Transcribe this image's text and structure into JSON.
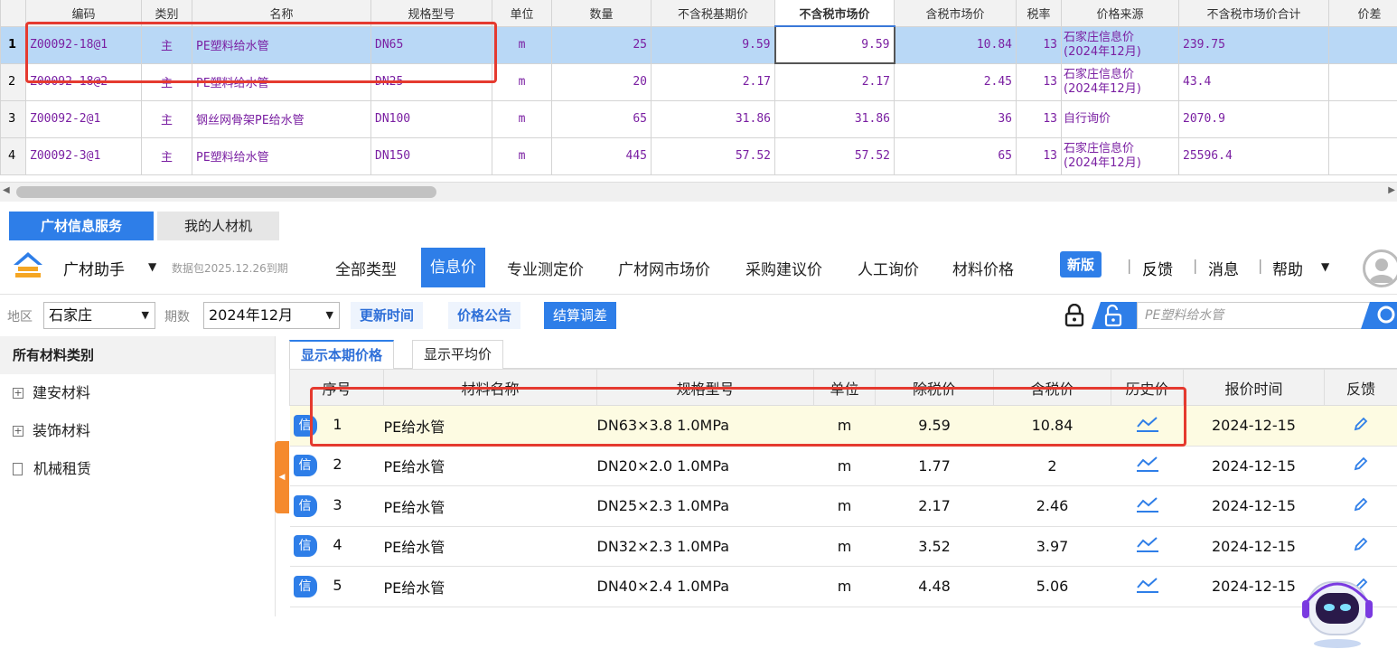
{
  "top_grid": {
    "columns": [
      "编码",
      "类别",
      "名称",
      "规格型号",
      "单位",
      "数量",
      "不含税基期价",
      "不含税市场价",
      "含税市场价",
      "税率",
      "价格来源",
      "不含税市场价合计",
      "价差"
    ],
    "rows": [
      {
        "n": "1",
        "code": "Z00092-18@1",
        "cat": "主",
        "name": "PE塑料给水管",
        "spec": "DN65",
        "unit": "m",
        "qty": "25",
        "base": "9.59",
        "market": "9.59",
        "tax_market": "10.84",
        "rate": "13",
        "src1": "石家庄信息价",
        "src2": "(2024年12月)",
        "total": "239.75"
      },
      {
        "n": "2",
        "code": "Z00092-18@2",
        "cat": "主",
        "name": "PE塑料给水管",
        "spec": "DN25",
        "unit": "m",
        "qty": "20",
        "base": "2.17",
        "market": "2.17",
        "tax_market": "2.45",
        "rate": "13",
        "src1": "石家庄信息价",
        "src2": "(2024年12月)",
        "total": "43.4"
      },
      {
        "n": "3",
        "code": "Z00092-2@1",
        "cat": "主",
        "name": "钢丝网骨架PE给水管",
        "spec": "DN100",
        "unit": "m",
        "qty": "65",
        "base": "31.86",
        "market": "31.86",
        "tax_market": "36",
        "rate": "13",
        "src1": "自行询价",
        "src2": "",
        "total": "2070.9"
      },
      {
        "n": "4",
        "code": "Z00092-3@1",
        "cat": "主",
        "name": "PE塑料给水管",
        "spec": "DN150",
        "unit": "m",
        "qty": "445",
        "base": "57.52",
        "market": "57.52",
        "tax_market": "65",
        "rate": "13",
        "src1": "石家庄信息价",
        "src2": "(2024年12月)",
        "total": "25596.4"
      }
    ]
  },
  "panel_tabs": [
    "广材信息服务",
    "我的人材机"
  ],
  "assistant": {
    "title": "广材助手",
    "package_expiry": "数据包2025.12.26到期",
    "nav": [
      "全部类型",
      "信息价",
      "专业测定价",
      "广材网市场价",
      "采购建议价",
      "人工询价",
      "材料价格"
    ],
    "active_nav": "信息价",
    "new_badge": "新版",
    "links": [
      "反馈",
      "消息",
      "帮助"
    ],
    "sep": "|",
    "caret": "▼"
  },
  "filters": {
    "region_label": "地区",
    "region_value": "石家庄",
    "period_label": "期数",
    "period_value": "2024年12月",
    "buttons": [
      "更新时间",
      "价格公告",
      "结算调差"
    ],
    "search_placeholder": "PE塑料给水管"
  },
  "tree": {
    "header": "所有材料类别",
    "items": [
      {
        "label": "建安材料",
        "expander": "+"
      },
      {
        "label": "装饰材料",
        "expander": "+"
      },
      {
        "label": "机械租赁",
        "expander": ""
      }
    ]
  },
  "price_panel": {
    "subtabs": [
      "显示本期价格",
      "显示平均价"
    ],
    "columns": [
      "序号",
      "材料名称",
      "规格型号",
      "单位",
      "除税价",
      "含税价",
      "历史价",
      "报价时间",
      "反馈"
    ],
    "badge": "信",
    "rows": [
      {
        "seq": "1",
        "name": "PE给水管",
        "spec": "DN63×3.8 1.0MPa",
        "unit": "m",
        "ex_tax": "9.59",
        "in_tax": "10.84",
        "date": "2024-12-15"
      },
      {
        "seq": "2",
        "name": "PE给水管",
        "spec": "DN20×2.0 1.0MPa",
        "unit": "m",
        "ex_tax": "1.77",
        "in_tax": "2",
        "date": "2024-12-15"
      },
      {
        "seq": "3",
        "name": "PE给水管",
        "spec": "DN25×2.3 1.0MPa",
        "unit": "m",
        "ex_tax": "2.17",
        "in_tax": "2.46",
        "date": "2024-12-15"
      },
      {
        "seq": "4",
        "name": "PE给水管",
        "spec": "DN32×2.3 1.0MPa",
        "unit": "m",
        "ex_tax": "3.52",
        "in_tax": "3.97",
        "date": "2024-12-15"
      },
      {
        "seq": "5",
        "name": "PE给水管",
        "spec": "DN40×2.4 1.0MPa",
        "unit": "m",
        "ex_tax": "4.48",
        "in_tax": "5.06",
        "date": "2024-12-15"
      }
    ]
  },
  "colors": {
    "accent": "#2e7ee8",
    "highlight_box": "#e53a2f",
    "grid_text": "#7a1fa2",
    "selected_row": "#b9d8f6"
  }
}
